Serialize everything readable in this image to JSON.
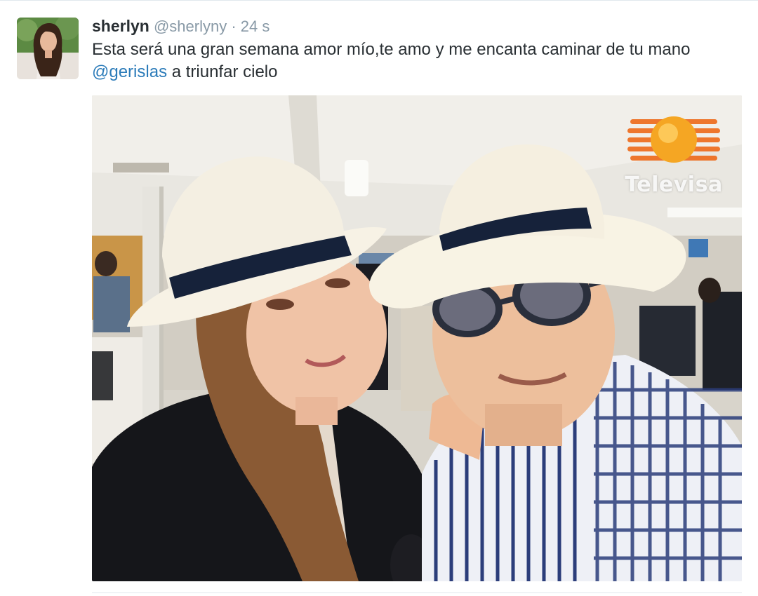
{
  "tweet": {
    "display_name": "sherlyn",
    "handle": "@sherlyny",
    "separator": "·",
    "timestamp": "24 s",
    "text_line1": "Esta será una gran semana amor mío,te amo y me encanta caminar de tu mano",
    "mention": "@gerislas",
    "text_line2_rest": " a triunfar cielo"
  },
  "media": {
    "watermark_text": "Televisa",
    "watermark_logo_colors": [
      "#f5a623",
      "#e85d04"
    ]
  },
  "colors": {
    "link": "#2b7bb9",
    "name": "#292f33",
    "muted": "#8899a6",
    "divider": "#e1e8ed"
  }
}
